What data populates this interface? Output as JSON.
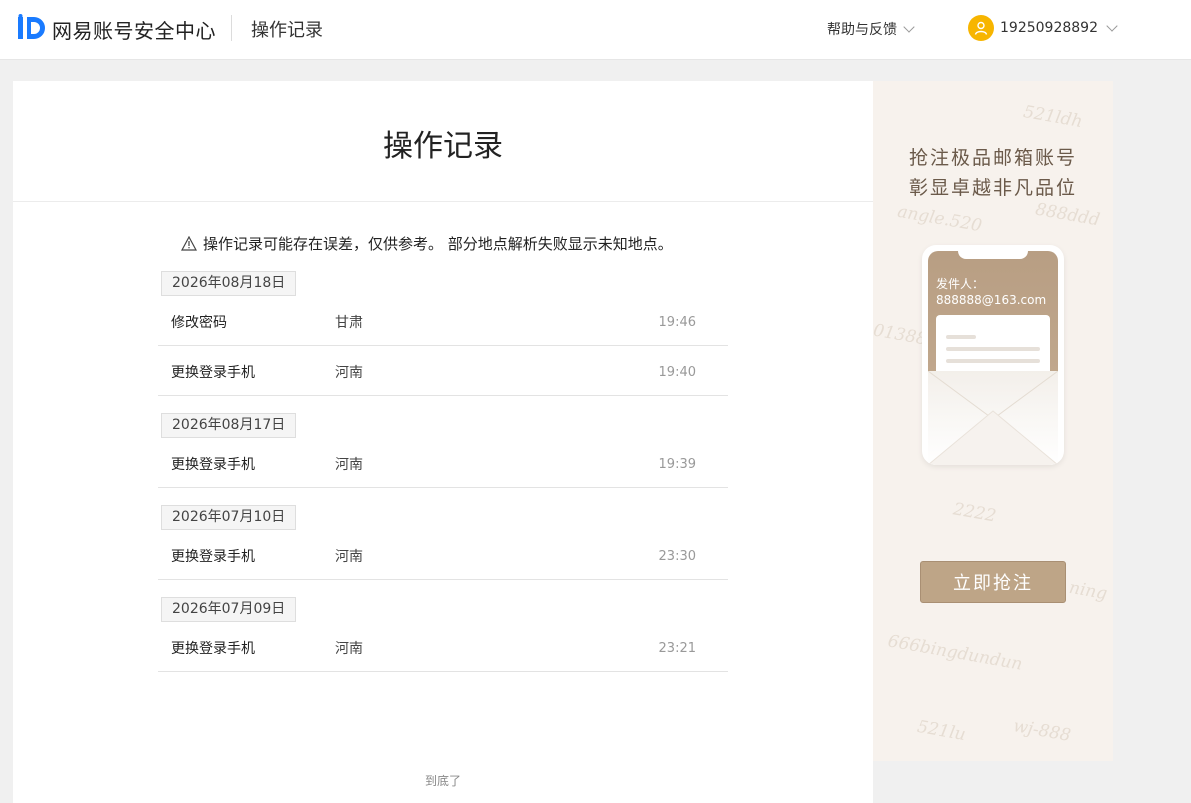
{
  "header": {
    "brand": "网易账号安全中心",
    "page_tab": "操作记录",
    "help_label": "帮助与反馈",
    "user_phone": "19250928892"
  },
  "main": {
    "title": "操作记录",
    "notice": "操作记录可能存在误差，仅供参考。 部分地点解析失败显示未知地点。",
    "groups": [
      {
        "date": "2026年08月18日",
        "rows": [
          {
            "operation": "修改密码",
            "location": "甘肃",
            "time": "19:46"
          },
          {
            "operation": "更换登录手机",
            "location": "河南",
            "time": "19:40"
          }
        ]
      },
      {
        "date": "2026年08月17日",
        "rows": [
          {
            "operation": "更换登录手机",
            "location": "河南",
            "time": "19:39"
          }
        ]
      },
      {
        "date": "2026年07月10日",
        "rows": [
          {
            "operation": "更换登录手机",
            "location": "河南",
            "time": "23:30"
          }
        ]
      },
      {
        "date": "2026年07月09日",
        "rows": [
          {
            "operation": "更换登录手机",
            "location": "河南",
            "time": "23:21"
          }
        ]
      }
    ],
    "end_text": "到底了"
  },
  "ad": {
    "line1": "抢注极品邮箱账号",
    "line2": "彰显卓越非凡品位",
    "sender_label": "发件人：",
    "sender_address": "888888@163.com",
    "button_label": "立即抢注",
    "watermarks": [
      "521ldh",
      "angle.520",
      "888ddd",
      "01388",
      "2222",
      "666bingdundun",
      "521lu",
      "wj-888",
      "ning"
    ]
  },
  "colors": {
    "accent_gold": "#bea587",
    "avatar": "#f7b500",
    "logo_blue": "#1a7bff"
  },
  "icons": {
    "warning": "warning-icon",
    "chevron": "chevron-down-icon",
    "avatar": "user-icon"
  }
}
